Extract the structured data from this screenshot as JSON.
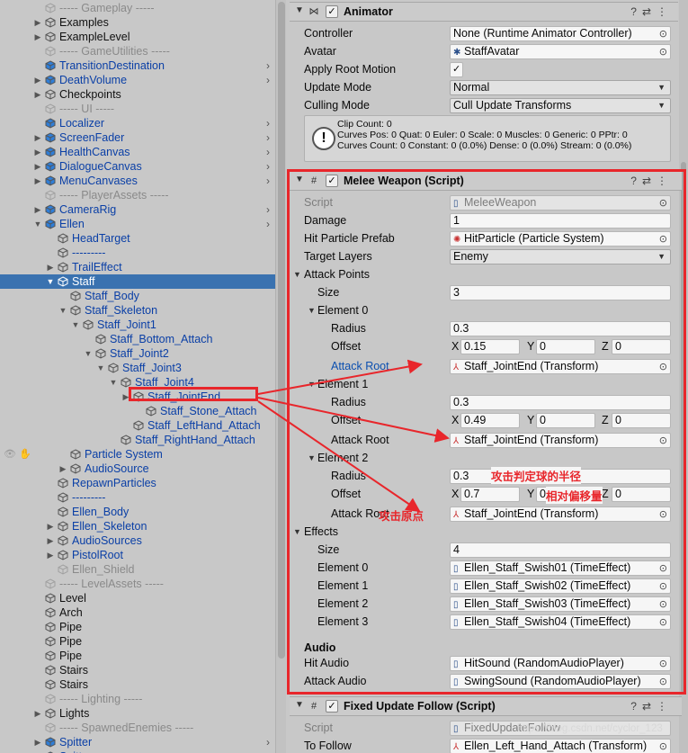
{
  "hierarchy": {
    "rows": [
      {
        "label": "----- Gameplay -----",
        "color": "grey",
        "icon": "cube-outline-icon",
        "indent": 1
      },
      {
        "label": "Examples",
        "color": "black",
        "icon": "cube-outline-icon",
        "indent": 1,
        "arrow": "right"
      },
      {
        "label": "ExampleLevel",
        "color": "black",
        "icon": "cube-outline-icon",
        "indent": 1,
        "arrow": "right"
      },
      {
        "label": "----- GameUtilities -----",
        "color": "grey",
        "icon": "cube-outline-icon",
        "indent": 1
      },
      {
        "label": "TransitionDestination",
        "color": "blue",
        "icon": "prefab-cube-icon",
        "indent": 1,
        "chev": true
      },
      {
        "label": "DeathVolume",
        "color": "blue",
        "icon": "prefab-cube-icon",
        "indent": 1,
        "arrow": "right",
        "chev": true
      },
      {
        "label": "Checkpoints",
        "color": "black",
        "icon": "cube-outline-icon",
        "indent": 1,
        "arrow": "right"
      },
      {
        "label": "----- UI -----",
        "color": "grey",
        "icon": "cube-outline-icon",
        "indent": 1
      },
      {
        "label": "Localizer",
        "color": "blue",
        "icon": "prefab-cube-icon",
        "indent": 1,
        "chev": true
      },
      {
        "label": "ScreenFader",
        "color": "blue",
        "icon": "prefab-cube-icon",
        "indent": 1,
        "arrow": "right",
        "chev": true
      },
      {
        "label": "HealthCanvas",
        "color": "blue",
        "icon": "prefab-cube-icon",
        "indent": 1,
        "arrow": "right",
        "chev": true
      },
      {
        "label": "DialogueCanvas",
        "color": "blue",
        "icon": "prefab-cube-icon",
        "indent": 1,
        "arrow": "right",
        "chev": true
      },
      {
        "label": "MenuCanvases",
        "color": "blue",
        "icon": "prefab-cube-icon",
        "indent": 1,
        "arrow": "right",
        "chev": true
      },
      {
        "label": "----- PlayerAssets -----",
        "color": "grey",
        "icon": "cube-outline-icon",
        "indent": 1
      },
      {
        "label": "CameraRig",
        "color": "blue",
        "icon": "prefab-cube-icon",
        "indent": 1,
        "arrow": "right",
        "chev": true
      },
      {
        "label": "Ellen",
        "color": "blue",
        "icon": "prefab-cube-icon",
        "indent": 1,
        "arrow": "down",
        "chev": true
      },
      {
        "label": "HeadTarget",
        "color": "blue",
        "icon": "cube-outline-icon",
        "indent": 2
      },
      {
        "label": "---------",
        "color": "blue",
        "icon": "cube-outline-icon",
        "indent": 2
      },
      {
        "label": "TrailEffect",
        "color": "blue",
        "icon": "cube-outline-icon",
        "indent": 2,
        "arrow": "right"
      },
      {
        "label": "Staff",
        "color": "blue",
        "icon": "cube-outline-icon",
        "indent": 2,
        "arrow": "down",
        "selected": true
      },
      {
        "label": "Staff_Body",
        "color": "blue",
        "icon": "cube-outline-icon",
        "indent": 3
      },
      {
        "label": "Staff_Skeleton",
        "color": "blue",
        "icon": "cube-outline-icon",
        "indent": 3,
        "arrow": "down"
      },
      {
        "label": "Staff_Joint1",
        "color": "blue",
        "icon": "cube-outline-icon",
        "indent": 4,
        "arrow": "down"
      },
      {
        "label": "Staff_Bottom_Attach",
        "color": "blue",
        "icon": "cube-outline-icon",
        "indent": 5
      },
      {
        "label": "Staff_Joint2",
        "color": "blue",
        "icon": "cube-outline-icon",
        "indent": 5,
        "arrow": "down"
      },
      {
        "label": "Staff_Joint3",
        "color": "blue",
        "icon": "cube-outline-icon",
        "indent": 6,
        "arrow": "down"
      },
      {
        "label": "Staff_Joint4",
        "color": "blue",
        "icon": "cube-outline-icon",
        "indent": 7,
        "arrow": "down"
      },
      {
        "label": "Staff_JointEnd",
        "color": "blue",
        "icon": "cube-outline-icon",
        "indent": 8,
        "arrow": "right"
      },
      {
        "label": "Staff_Stone_Attach",
        "color": "blue",
        "icon": "cube-outline-icon",
        "indent": 9
      },
      {
        "label": "Staff_LeftHand_Attach",
        "color": "blue",
        "icon": "cube-outline-icon",
        "indent": 8
      },
      {
        "label": "Staff_RightHand_Attach",
        "color": "blue",
        "icon": "cube-outline-icon",
        "indent": 7
      },
      {
        "label": "Particle System",
        "color": "blue",
        "icon": "cube-outline-icon",
        "indent": 3
      },
      {
        "label": "AudioSource",
        "color": "blue",
        "icon": "cube-outline-icon",
        "indent": 3,
        "arrow": "right"
      },
      {
        "label": "RepawnParticles",
        "color": "blue",
        "icon": "cube-outline-icon",
        "indent": 2
      },
      {
        "label": "---------",
        "color": "blue",
        "icon": "cube-outline-icon",
        "indent": 2
      },
      {
        "label": "Ellen_Body",
        "color": "blue",
        "icon": "cube-outline-icon",
        "indent": 2
      },
      {
        "label": "Ellen_Skeleton",
        "color": "blue",
        "icon": "cube-outline-icon",
        "indent": 2,
        "arrow": "right"
      },
      {
        "label": "AudioSources",
        "color": "blue",
        "icon": "cube-outline-icon",
        "indent": 2,
        "arrow": "right"
      },
      {
        "label": "PistolRoot",
        "color": "blue",
        "icon": "cube-outline-icon",
        "indent": 2,
        "arrow": "right"
      },
      {
        "label": "Ellen_Shield",
        "color": "grey",
        "icon": "cube-outline-icon",
        "indent": 2
      },
      {
        "label": "----- LevelAssets -----",
        "color": "grey",
        "icon": "cube-outline-icon",
        "indent": 1
      },
      {
        "label": "Level",
        "color": "black",
        "icon": "cube-outline-icon",
        "indent": 1
      },
      {
        "label": "Arch",
        "color": "black",
        "icon": "cube-outline-icon",
        "indent": 1
      },
      {
        "label": "Pipe",
        "color": "black",
        "icon": "cube-outline-icon",
        "indent": 1
      },
      {
        "label": "Pipe",
        "color": "black",
        "icon": "cube-outline-icon",
        "indent": 1
      },
      {
        "label": "Pipe",
        "color": "black",
        "icon": "cube-outline-icon",
        "indent": 1
      },
      {
        "label": "Stairs",
        "color": "black",
        "icon": "cube-outline-icon",
        "indent": 1
      },
      {
        "label": "Stairs",
        "color": "black",
        "icon": "cube-outline-icon",
        "indent": 1
      },
      {
        "label": "----- Lighting -----",
        "color": "grey",
        "icon": "cube-outline-icon",
        "indent": 1
      },
      {
        "label": "Lights",
        "color": "black",
        "icon": "cube-outline-icon",
        "indent": 1,
        "arrow": "right"
      },
      {
        "label": "----- SpawnedEnemies -----",
        "color": "grey",
        "icon": "cube-outline-icon",
        "indent": 1
      },
      {
        "label": "Spitter",
        "color": "blue",
        "icon": "prefab-cube-icon",
        "indent": 1,
        "arrow": "right",
        "chev": true
      },
      {
        "label": "Spitter",
        "color": "blue",
        "icon": "prefab-cube-icon",
        "indent": 1,
        "arrow": "right",
        "chev": true
      }
    ]
  },
  "animator": {
    "title": "Animator",
    "controller_label": "Controller",
    "controller_value": "None (Runtime Animator Controller)",
    "avatar_label": "Avatar",
    "avatar_value": "StaffAvatar",
    "apply_root_motion_label": "Apply Root Motion",
    "apply_root_motion_checked": "✓",
    "update_mode_label": "Update Mode",
    "update_mode_value": "Normal",
    "culling_mode_label": "Culling Mode",
    "culling_mode_value": "Cull Update Transforms",
    "info_icon": "!",
    "info_line1": "Clip Count: 0",
    "info_line2": "Curves Pos: 0 Quat: 0 Euler: 0 Scale: 0 Muscles: 0 Generic: 0 PPtr: 0",
    "info_line3": "Curves Count: 0 Constant: 0 (0.0%) Dense: 0 (0.0%) Stream: 0 (0.0%)"
  },
  "melee": {
    "title": "Melee Weapon (Script)",
    "script_label": "Script",
    "script_value": "MeleeWeapon",
    "damage_label": "Damage",
    "damage_value": "1",
    "hit_particle_label": "Hit Particle Prefab",
    "hit_particle_value": "HitParticle (Particle System)",
    "target_layers_label": "Target Layers",
    "target_layers_value": "Enemy",
    "attack_points_label": "Attack Points",
    "size_label": "Size",
    "attack_points_size": "3",
    "elements": [
      {
        "label": "Element 0",
        "radius_label": "Radius",
        "radius": "0.3",
        "offset_label": "Offset",
        "x": "0.15",
        "y": "0",
        "z": "0",
        "root_label": "Attack Root",
        "root": "Staff_JointEnd (Transform)"
      },
      {
        "label": "Element 1",
        "radius_label": "Radius",
        "radius": "0.3",
        "offset_label": "Offset",
        "x": "0.49",
        "y": "0",
        "z": "0",
        "root_label": "Attack Root",
        "root": "Staff_JointEnd (Transform)"
      },
      {
        "label": "Element 2",
        "radius_label": "Radius",
        "radius": "0.3",
        "offset_label": "Offset",
        "x": "0.7",
        "y": "0",
        "z": "0",
        "root_label": "Attack Root",
        "root": "Staff_JointEnd (Transform)"
      }
    ],
    "axis_x": "X",
    "axis_y": "Y",
    "axis_z": "Z",
    "effects_label": "Effects",
    "effects_size": "4",
    "effects": [
      {
        "label": "Element 0",
        "value": "Ellen_Staff_Swish01 (TimeEffect)"
      },
      {
        "label": "Element 1",
        "value": "Ellen_Staff_Swish02 (TimeEffect)"
      },
      {
        "label": "Element 2",
        "value": "Ellen_Staff_Swish03 (TimeEffect)"
      },
      {
        "label": "Element 3",
        "value": "Ellen_Staff_Swish04 (TimeEffect)"
      }
    ],
    "audio_header": "Audio",
    "hit_audio_label": "Hit Audio",
    "hit_audio_value": "HitSound (RandomAudioPlayer)",
    "attack_audio_label": "Attack Audio",
    "attack_audio_value": "SwingSound (RandomAudioPlayer)"
  },
  "fixed_follow": {
    "title": "Fixed Update Follow (Script)",
    "script_label": "Script",
    "script_value": "FixedUpdateFollow",
    "to_follow_label": "To Follow",
    "to_follow_value": "Ellen_Left_Hand_Attach (Transform)"
  },
  "annotations": {
    "radius_note": "攻击判定球的半径",
    "offset_note": "相对偏移量",
    "origin_note": "攻击原点",
    "color": "#e8262b"
  },
  "watermark": "https://blog.csdn.net/cyclor_123"
}
